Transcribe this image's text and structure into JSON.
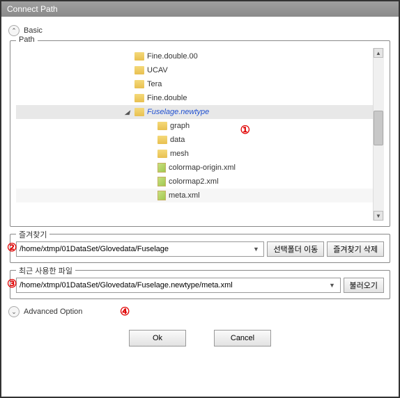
{
  "title": "Connect Path",
  "sections": {
    "basic": "Basic",
    "advanced": "Advanced Option"
  },
  "path": {
    "group_label": "Path",
    "items": [
      {
        "name": "Fine.double.00",
        "type": "folder",
        "level": 0
      },
      {
        "name": "UCAV",
        "type": "folder",
        "level": 0
      },
      {
        "name": "Tera",
        "type": "folder",
        "level": 0
      },
      {
        "name": "Fine.double",
        "type": "folder",
        "level": 0
      },
      {
        "name": "Fuselage.newtype",
        "type": "folder",
        "level": 0,
        "selected": true,
        "expanded": true
      },
      {
        "name": "graph",
        "type": "folder",
        "level": 1
      },
      {
        "name": "data",
        "type": "folder",
        "level": 1
      },
      {
        "name": "mesh",
        "type": "folder",
        "level": 1
      },
      {
        "name": "colormap-origin.xml",
        "type": "file",
        "level": 1
      },
      {
        "name": "colormap2.xml",
        "type": "file",
        "level": 1
      },
      {
        "name": "meta.xml",
        "type": "file",
        "level": 1,
        "highlighted": true
      }
    ]
  },
  "bookmark": {
    "group_label": "즐겨찾기",
    "value": "/home/xtmp/01DataSet/Glovedata/Fuselage",
    "goto_btn": "선택폴더 이동",
    "delete_btn": "즐겨찾기 삭제"
  },
  "recent": {
    "group_label": "최근 사용한 파일",
    "value": "/home/xtmp/01DataSet/Glovedata/Fuselage.newtype/meta.xml",
    "load_btn": "불러오기"
  },
  "buttons": {
    "ok": "Ok",
    "cancel": "Cancel"
  },
  "annotations": [
    "①",
    "②",
    "③",
    "④"
  ]
}
